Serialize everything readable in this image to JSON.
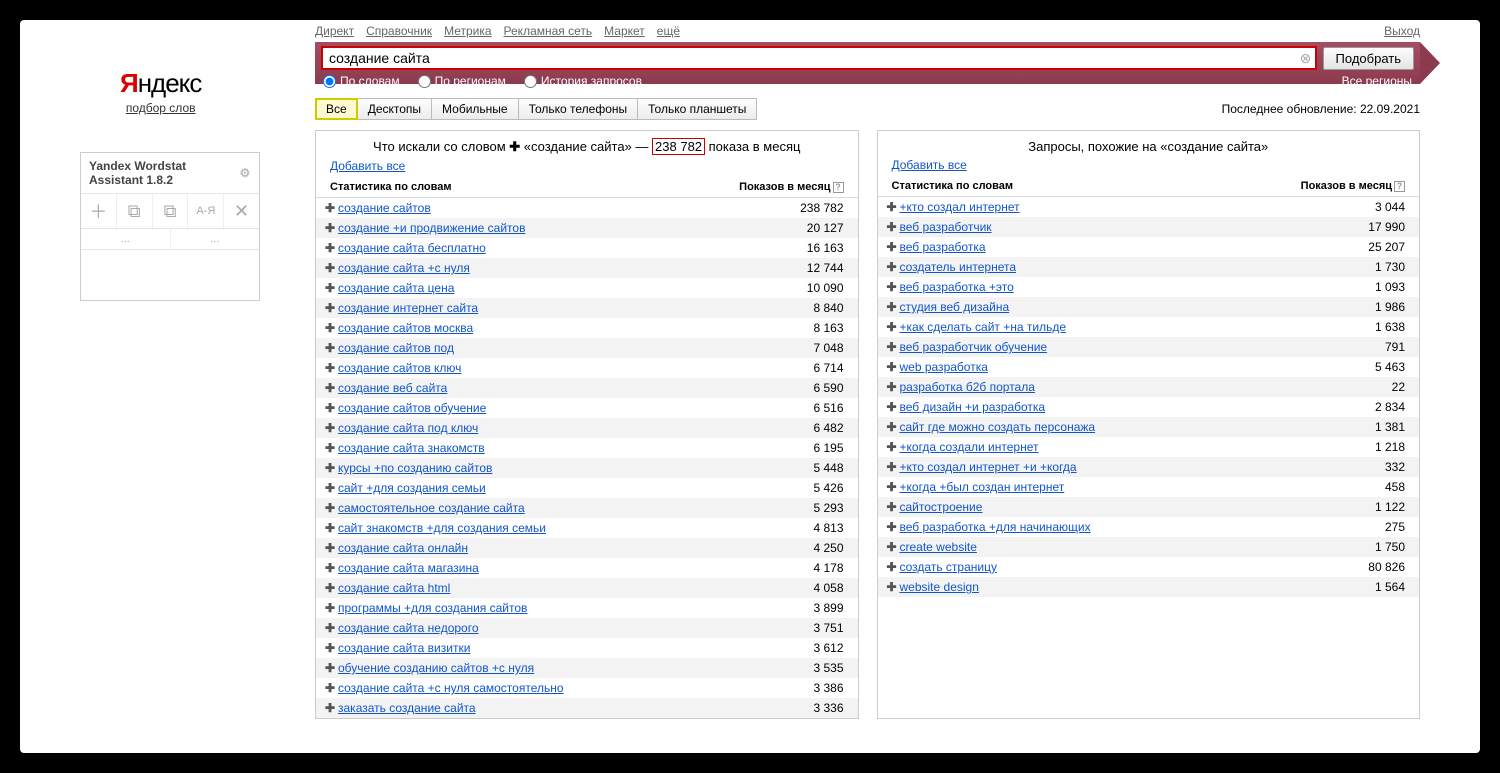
{
  "topnav": {
    "links": [
      "Директ",
      "Справочник",
      "Метрика",
      "Рекламная сеть",
      "Маркет",
      "ещё"
    ],
    "logout": "Выход"
  },
  "logo": {
    "main_pre": "Я",
    "main_post": "ндекс",
    "sub": "подбор слов"
  },
  "search": {
    "value": "создание сайта",
    "submit": "Подобрать",
    "radios": {
      "by_words": "По словам",
      "by_regions": "По регионам",
      "history": "История запросов"
    },
    "regions_link": "Все регионы"
  },
  "tabs": {
    "items": [
      "Все",
      "Десктопы",
      "Мобильные",
      "Только телефоны",
      "Только планшеты"
    ],
    "update": "Последнее обновление: 22.09.2021"
  },
  "widget": {
    "title": "Yandex Wordstat Assistant 1.8.2",
    "counts": [
      "...",
      "..."
    ]
  },
  "left_panel": {
    "title_pre": "Что искали со словом ",
    "title_quote": "«создание сайта»",
    "title_dash": " — ",
    "title_count": "238 782",
    "title_post": " показа в месяц",
    "add_all": "Добавить все",
    "head_stat": "Статистика по словам",
    "head_imp": "Показов в месяц",
    "rows": [
      {
        "kw": "создание сайтов",
        "imp": "238 782"
      },
      {
        "kw": "создание +и продвижение сайтов",
        "imp": "20 127"
      },
      {
        "kw": "создание сайта бесплатно",
        "imp": "16 163"
      },
      {
        "kw": "создание сайта +с нуля",
        "imp": "12 744"
      },
      {
        "kw": "создание сайта цена",
        "imp": "10 090"
      },
      {
        "kw": "создание интернет сайта",
        "imp": "8 840"
      },
      {
        "kw": "создание сайтов москва",
        "imp": "8 163"
      },
      {
        "kw": "создание сайтов под",
        "imp": "7 048"
      },
      {
        "kw": "создание сайтов ключ",
        "imp": "6 714"
      },
      {
        "kw": "создание веб сайта",
        "imp": "6 590"
      },
      {
        "kw": "создание сайтов обучение",
        "imp": "6 516"
      },
      {
        "kw": "создание сайта под ключ",
        "imp": "6 482"
      },
      {
        "kw": "создание сайта знакомств",
        "imp": "6 195"
      },
      {
        "kw": "курсы +по созданию сайтов",
        "imp": "5 448"
      },
      {
        "kw": "сайт +для создания семьи",
        "imp": "5 426"
      },
      {
        "kw": "самостоятельное создание сайта",
        "imp": "5 293"
      },
      {
        "kw": "сайт знакомств +для создания семьи",
        "imp": "4 813"
      },
      {
        "kw": "создание сайта онлайн",
        "imp": "4 250"
      },
      {
        "kw": "создание сайта магазина",
        "imp": "4 178"
      },
      {
        "kw": "создание сайта html",
        "imp": "4 058"
      },
      {
        "kw": "программы +для создания сайтов",
        "imp": "3 899"
      },
      {
        "kw": "создание сайта недорого",
        "imp": "3 751"
      },
      {
        "kw": "создание сайта визитки",
        "imp": "3 612"
      },
      {
        "kw": "обучение созданию сайтов +с нуля",
        "imp": "3 535"
      },
      {
        "kw": "создание сайта +с нуля самостоятельно",
        "imp": "3 386"
      },
      {
        "kw": "заказать создание сайта",
        "imp": "3 336"
      }
    ]
  },
  "right_panel": {
    "title": "Запросы, похожие на «создание сайта»",
    "add_all": "Добавить все",
    "head_stat": "Статистика по словам",
    "head_imp": "Показов в месяц",
    "rows": [
      {
        "kw": "+кто создал интернет",
        "imp": "3 044"
      },
      {
        "kw": "веб разработчик",
        "imp": "17 990"
      },
      {
        "kw": "веб разработка",
        "imp": "25 207"
      },
      {
        "kw": "создатель интернета",
        "imp": "1 730"
      },
      {
        "kw": "веб разработка +это",
        "imp": "1 093"
      },
      {
        "kw": "студия веб дизайна",
        "imp": "1 986"
      },
      {
        "kw": "+как сделать сайт +на тильде",
        "imp": "1 638"
      },
      {
        "kw": "веб разработчик обучение",
        "imp": "791"
      },
      {
        "kw": "web разработка",
        "imp": "5 463"
      },
      {
        "kw": "разработка б2б портала",
        "imp": "22"
      },
      {
        "kw": "веб дизайн +и разработка",
        "imp": "2 834"
      },
      {
        "kw": "сайт где можно создать персонажа",
        "imp": "1 381"
      },
      {
        "kw": "+когда создали интернет",
        "imp": "1 218"
      },
      {
        "kw": "+кто создал интернет +и +когда",
        "imp": "332"
      },
      {
        "kw": "+когда +был создан интернет",
        "imp": "458"
      },
      {
        "kw": "сайтостроение",
        "imp": "1 122"
      },
      {
        "kw": "веб разработка +для начинающих",
        "imp": "275"
      },
      {
        "kw": "create website",
        "imp": "1 750"
      },
      {
        "kw": "создать страницу",
        "imp": "80 826"
      },
      {
        "kw": "website design",
        "imp": "1 564"
      }
    ]
  }
}
